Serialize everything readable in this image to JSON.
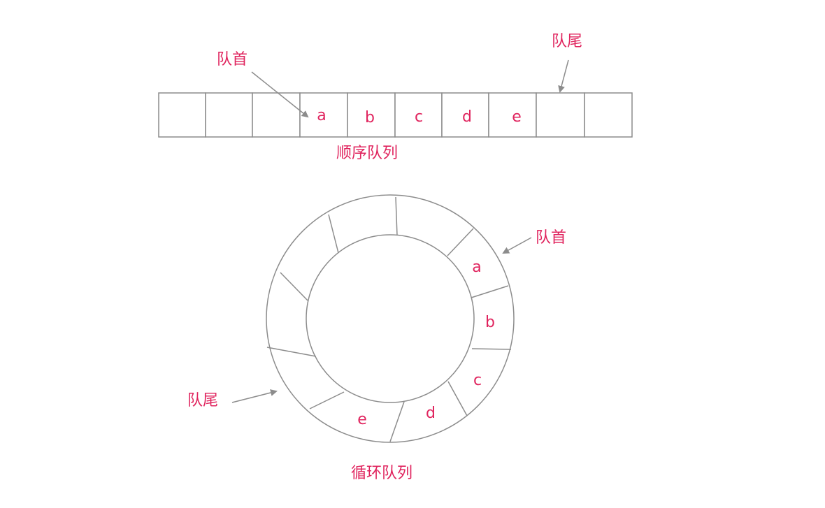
{
  "linear_queue": {
    "caption": "顺序队列",
    "head_label": "队首",
    "tail_label": "队尾",
    "cells": [
      "",
      "",
      "",
      "a",
      "b",
      "c",
      "d",
      "e",
      "",
      ""
    ]
  },
  "circular_queue": {
    "caption": "循环队列",
    "head_label": "队首",
    "tail_label": "队尾",
    "cells": [
      "a",
      "b",
      "c",
      "d",
      "e"
    ]
  },
  "colors": {
    "label": "#e0245e",
    "line": "#8c8c8c"
  }
}
